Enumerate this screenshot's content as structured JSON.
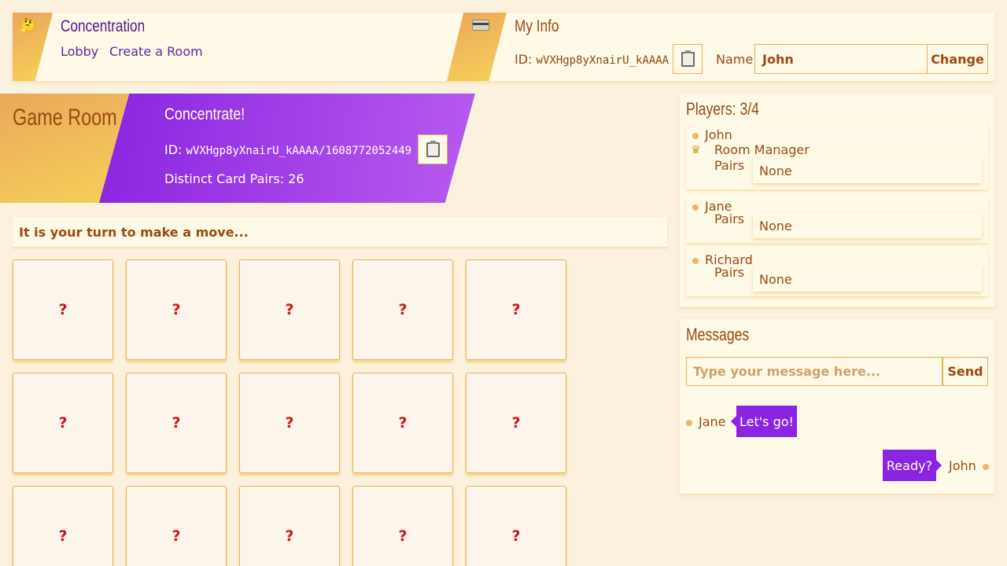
{
  "app_header": {
    "emoji": "🤔",
    "title": "Concentration",
    "nav": [
      "Lobby",
      "Create a Room"
    ]
  },
  "my_info": {
    "icon": "id-card-icon",
    "title": "My Info",
    "id_label": "ID:",
    "id_value": "wVXHgp8yXnairU_kAAAA",
    "name_label": "Name",
    "name_value": "John",
    "change_label": "Change"
  },
  "room": {
    "banner_title": "Game Room",
    "name": "Concentrate!",
    "id_label": "ID:",
    "id_value": "wVXHgp8yXnairU_kAAAA/1608772052449",
    "pairs_text": "Distinct Card Pairs: 26"
  },
  "turn_message": "It is your turn to make a move...",
  "cards": [
    "?",
    "?",
    "?",
    "?",
    "?",
    "?",
    "?",
    "?",
    "?",
    "?",
    "?",
    "?",
    "?",
    "?",
    "?"
  ],
  "players": {
    "title": "Players: 3/4",
    "pairs_label": "Pairs",
    "list": [
      {
        "name": "John",
        "role": "Room Manager",
        "role_icon": "crown-icon",
        "pairs": "None"
      },
      {
        "name": "Jane",
        "pairs": "None"
      },
      {
        "name": "Richard",
        "pairs": "None"
      }
    ]
  },
  "messages": {
    "title": "Messages",
    "placeholder": "Type your message here...",
    "send_label": "Send",
    "items": [
      {
        "from": "Jane",
        "text": "Let's go!",
        "side": "left"
      },
      {
        "from": "John",
        "text": "Ready?",
        "side": "right"
      }
    ]
  },
  "colors": {
    "accent_purple": "#8a24e0",
    "accent_orange": "#eaa85a",
    "text_brown": "#9a4a12",
    "card_mark": "#d0131c"
  }
}
